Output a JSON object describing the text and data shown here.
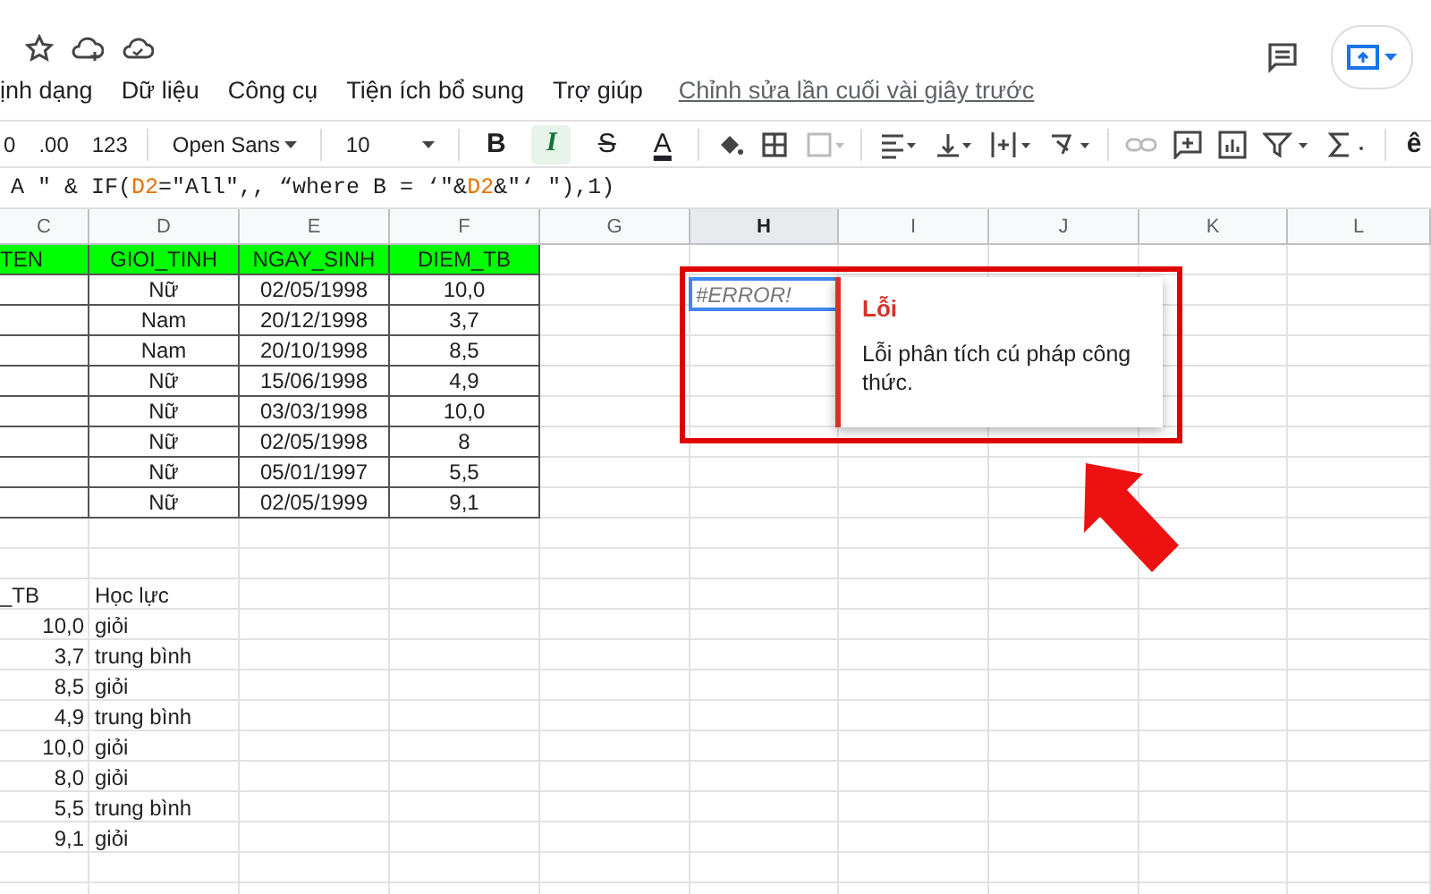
{
  "menu": [
    "ịnh dạng",
    "Dữ liệu",
    "Công cụ",
    "Tiện ích bổ sung",
    "Trợ giúp"
  ],
  "last_edit": "Chỉnh sửa lần cuối vài giây trước",
  "toolbar": {
    "number_formats": [
      "0",
      ".00",
      "123"
    ],
    "font": "Open Sans",
    "font_size": "10",
    "format_buttons": [
      {
        "label": "B",
        "selected": false
      },
      {
        "label": "I",
        "selected": true
      },
      {
        "label": "S",
        "selected": false
      },
      {
        "label": "A",
        "selected": false
      }
    ],
    "input_tool": "ê"
  },
  "formula": [
    {
      "kind": "text",
      "text": "A \" & IF("
    },
    {
      "kind": "ref",
      "text": "D2"
    },
    {
      "kind": "text",
      "text": "=\"All\",, “where B = ‘\"&"
    },
    {
      "kind": "ref",
      "text": "D2"
    },
    {
      "kind": "text",
      "text": "&\"‘ \"),1)"
    }
  ],
  "columns": [
    {
      "label": "C",
      "selected": false
    },
    {
      "label": "D",
      "selected": false
    },
    {
      "label": "E",
      "selected": false
    },
    {
      "label": "F",
      "selected": false
    },
    {
      "label": "G",
      "selected": false
    },
    {
      "label": "H",
      "selected": true
    },
    {
      "label": "I",
      "selected": false
    },
    {
      "label": "J",
      "selected": false
    },
    {
      "label": "K",
      "selected": false
    },
    {
      "label": "L",
      "selected": false
    }
  ],
  "table": {
    "header": [
      "TEN",
      "GIOI_TINH",
      "NGAY_SINH",
      "DIEM_TB"
    ],
    "rows": [
      [
        "Nữ",
        "02/05/1998",
        "10,0"
      ],
      [
        "Nam",
        "20/12/1998",
        "3,7"
      ],
      [
        "Nam",
        "20/10/1998",
        "8,5"
      ],
      [
        "Nữ",
        "15/06/1998",
        "4,9"
      ],
      [
        "Nữ",
        "03/03/1998",
        "10,0"
      ],
      [
        "Nữ",
        "02/05/1998",
        "8"
      ],
      [
        "Nữ",
        "05/01/1997",
        "5,5"
      ],
      [
        "Nữ",
        "02/05/1999",
        "9,1"
      ]
    ]
  },
  "error_cell": {
    "value": "#ERROR!"
  },
  "error_popup": {
    "title": "Lỗi",
    "message": "Lỗi phân tích cú pháp công thức."
  },
  "summary": {
    "header": [
      "_TB",
      "Học lực"
    ],
    "rows": [
      [
        "10,0",
        "giỏi"
      ],
      [
        "3,7",
        "trung bình"
      ],
      [
        "8,5",
        "giỏi"
      ],
      [
        "4,9",
        "trung bình"
      ],
      [
        "10,0",
        "giỏi"
      ],
      [
        "8,0",
        "giỏi"
      ],
      [
        "5,5",
        "trung bình"
      ],
      [
        "9,1",
        "giỏi"
      ]
    ]
  }
}
